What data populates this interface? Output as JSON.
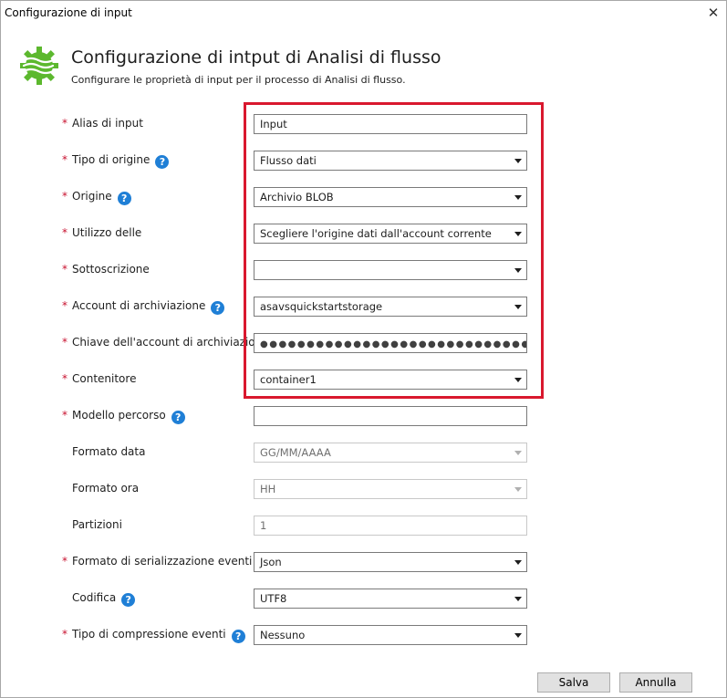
{
  "window": {
    "title": "Configurazione di input",
    "close_glyph": "✕"
  },
  "header": {
    "title": "Configurazione di intput di Analisi di flusso",
    "subtitle": "Configurare le proprietà di input per il processo di Analisi di flusso."
  },
  "form": {
    "required_marker": "*",
    "help_glyph": "?",
    "fields": [
      {
        "label": "Alias di input",
        "value": "Input"
      },
      {
        "label": "Tipo di origine",
        "value": "Flusso dati"
      },
      {
        "label": "Origine",
        "value": "Archivio BLOB"
      },
      {
        "label": "Utilizzo delle",
        "value": "Scegliere l'origine dati dall'account corrente"
      },
      {
        "label": "Sottoscrizione",
        "value": ""
      },
      {
        "label": "Account di archiviazione",
        "value": "asavsquickstartstorage"
      },
      {
        "label": "Chiave dell'account di archiviazione",
        "value": "●●●●●●●●●●●●●●●●●●●●●●●●●●●●●●●●●●●●●●●●●●●●●"
      },
      {
        "label": "Contenitore",
        "value": "container1"
      },
      {
        "label": "Modello percorso",
        "value": ""
      },
      {
        "label": "Formato data",
        "value": "GG/MM/AAAA"
      },
      {
        "label": "Formato ora",
        "value": "HH"
      },
      {
        "label": "Partizioni",
        "value": "1"
      },
      {
        "label": "Formato di serializzazione eventi",
        "value": "Json"
      },
      {
        "label": "Codifica",
        "value": "UTF8"
      },
      {
        "label": "Tipo di compressione eventi",
        "value": "Nessuno"
      }
    ]
  },
  "buttons": {
    "save": "Salva",
    "cancel": "Annulla"
  },
  "colors": {
    "highlight": "#d9182e",
    "required": "#c8102e",
    "help": "#1f7fd6",
    "logo": "#5cb82e"
  }
}
